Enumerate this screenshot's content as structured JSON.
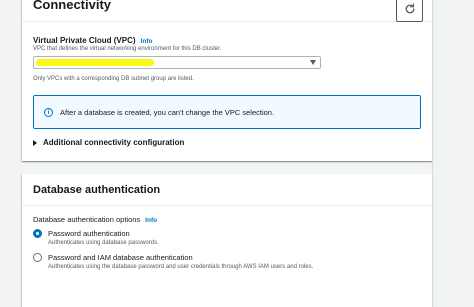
{
  "connectivity": {
    "title": "Connectivity",
    "refresh_icon": "refresh-icon",
    "vpc": {
      "label": "Virtual Private Cloud (VPC)",
      "info": "Info",
      "description": "VPC that defines the virtual networking environment for this DB cluster.",
      "selected_value": "",
      "hint": "Only VPCs with a corresponding DB subnet group are listed."
    },
    "alert": {
      "icon": "info-circle-icon",
      "text": "After a database is created, you can't change the VPC selection."
    },
    "additional": {
      "label": "Additional connectivity configuration"
    }
  },
  "database_authentication": {
    "title": "Database authentication",
    "options_label": "Database authentication options",
    "info": "Info",
    "options": [
      {
        "label": "Password authentication",
        "description": "Authenticates using database passwords.",
        "selected": true
      },
      {
        "label": "Password and IAM database authentication",
        "description": "Authenticates using the database password and user credentials through AWS IAM users and roles.",
        "selected": false
      }
    ]
  },
  "colors": {
    "accent": "#0073bb",
    "highlight": "#fbf718",
    "background": "#f2f3f3"
  }
}
